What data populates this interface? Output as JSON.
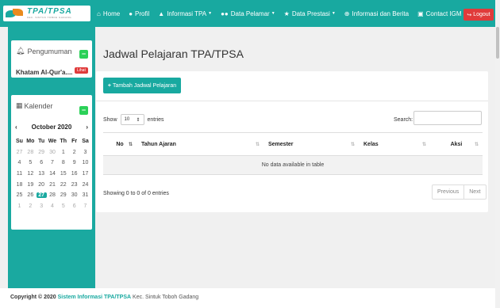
{
  "brand": {
    "name": "TPA/TPSA",
    "tagline": "KEC. SINTUK TOBOH GADANG"
  },
  "nav": [
    {
      "icon": "home-icon",
      "glyph": "⌂",
      "label": "Home",
      "caret": false
    },
    {
      "icon": "user-icon",
      "glyph": "👤",
      "label": "Profil",
      "caret": false
    },
    {
      "icon": "graduation-cap-icon",
      "glyph": "🎓",
      "label": "Informasi TPA",
      "caret": true
    },
    {
      "icon": "users-icon",
      "glyph": "👥",
      "label": "Data Pelamar",
      "caret": true
    },
    {
      "icon": "star-icon",
      "glyph": "★",
      "label": "Data Prestasi",
      "caret": true
    },
    {
      "icon": "globe-icon",
      "glyph": "⊕",
      "label": "Informasi dan Berita",
      "caret": false
    },
    {
      "icon": "id-card-icon",
      "glyph": "▣",
      "label": "Contact IGM",
      "caret": false
    }
  ],
  "logout_label": "Logout",
  "announcement": {
    "title": "Pengumuman",
    "item": "Khatam Al-Qur'a....",
    "badge": "Lihat"
  },
  "calendar": {
    "title": "Kalender",
    "month": "October 2020",
    "dow": [
      "Su",
      "Mo",
      "Tu",
      "We",
      "Th",
      "Fr",
      "Sa"
    ],
    "weeks": [
      [
        "27",
        "28",
        "29",
        "30",
        "1",
        "2",
        "3"
      ],
      [
        "4",
        "5",
        "6",
        "7",
        "8",
        "9",
        "10"
      ],
      [
        "11",
        "12",
        "13",
        "14",
        "15",
        "16",
        "17"
      ],
      [
        "18",
        "19",
        "20",
        "21",
        "22",
        "23",
        "24"
      ],
      [
        "25",
        "26",
        "27",
        "28",
        "29",
        "30",
        "31"
      ],
      [
        "1",
        "2",
        "3",
        "4",
        "5",
        "6",
        "7"
      ]
    ],
    "today": "27"
  },
  "main": {
    "title": "Jadwal Pelajaran TPA/TPSA",
    "add_button": "Tambah Jadwal Pelajaran",
    "show_label": "Show",
    "entries_value": "10",
    "entries_label": "entries",
    "search_label": "Search:",
    "columns": [
      "No",
      "Tahun Ajaran",
      "Semester",
      "Kelas",
      "Aksi"
    ],
    "empty_text": "No data available in table",
    "info": "Showing 0 to 0 of 0 entries",
    "prev": "Previous",
    "next": "Next"
  },
  "footer": {
    "prefix": "Copyright © 2020",
    "brand": "Sistem Informasi TPA/TPSA",
    "suffix": "Kec. Sintuk Toboh Gadang"
  },
  "colors": {
    "primary": "#18a9a0",
    "danger": "#e03b3b",
    "success": "#2bd158"
  }
}
